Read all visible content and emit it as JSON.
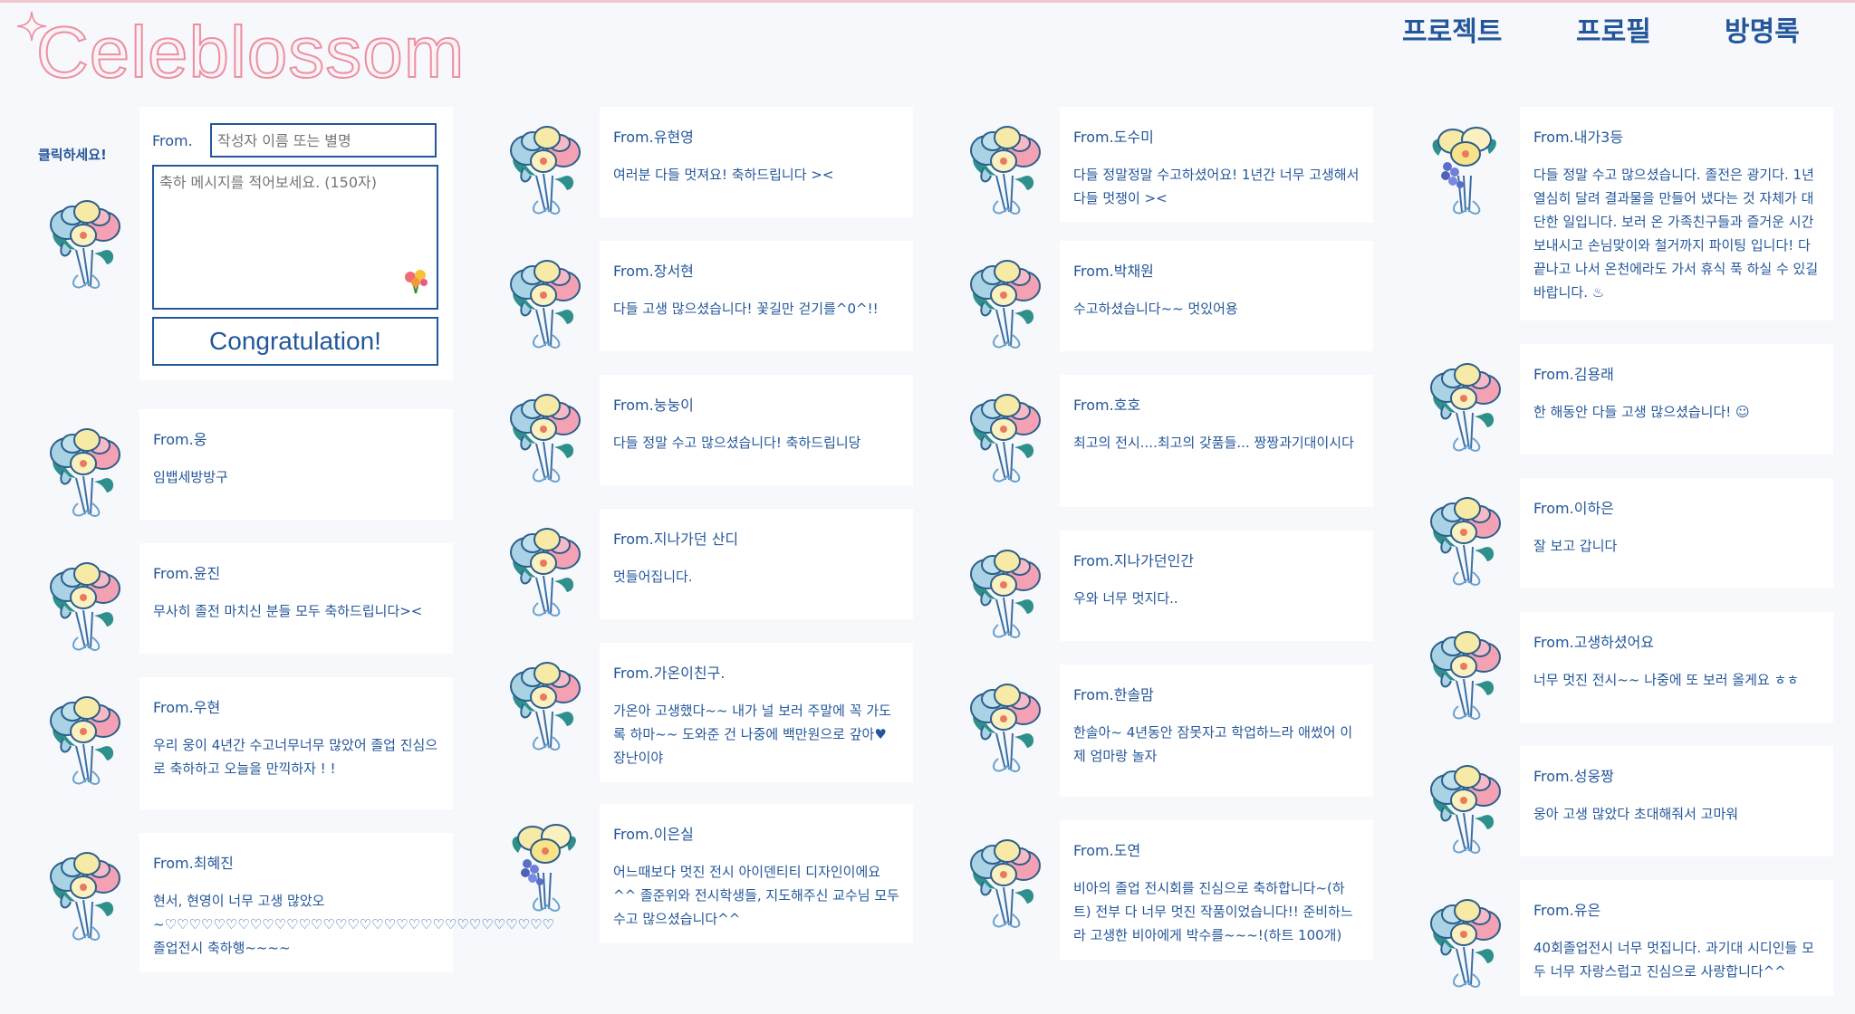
{
  "brand": {
    "logo_text": "Celeblossom"
  },
  "nav": [
    "프로젝트",
    "프로필",
    "방명록"
  ],
  "composer": {
    "hint": "클릭하세요!",
    "from_label": "From.",
    "name_placeholder": "작성자 이름 또는 별명",
    "message_placeholder": "축하 메시지를 적어보세요. (150자)",
    "submit_label": "Congratulation!"
  },
  "columns": [
    [
      {
        "from": "From.웅",
        "message": "임뱁세방방구",
        "bouquet": "blue-pink"
      },
      {
        "from": "From.윤진",
        "message": "무사히 졸전 마치신 분들 모두 축하드립니다><",
        "bouquet": "blue-pink"
      },
      {
        "from": "From.우현",
        "message": "우리 웅이 4년간 수고너무너무 많았어 졸업 진심으로 축하하고 오늘을 만끽하자 ! !",
        "bouquet": "blue-pink"
      },
      {
        "from": "From.최혜진",
        "message": "현서, 현영이 너무 고생 많았오~♡♡♡♡♡♡♡♡♡♡♡♡♡♡♡♡♡♡♡♡♡♡♡♡♡♡♡♡♡♡♡♡ 졸업전시 축하행~~~~",
        "bouquet": "blue-pink"
      }
    ],
    [
      {
        "from": "From.유현영",
        "message": "여러분 다들 멋져요! 축하드립니다 ><",
        "bouquet": "blue-pink"
      },
      {
        "from": "From.장서현",
        "message": "다들 고생 많으셨습니다! 꽃길만 걷기를^0^!!",
        "bouquet": "blue-pink"
      },
      {
        "from": "From.눙눙이",
        "message": "다들 정말 수고 많으셨습니다! 축하드립니당",
        "bouquet": "blue-pink"
      },
      {
        "from": "From.지나가던 산디",
        "message": "멋들어집니다.",
        "bouquet": "blue-pink"
      },
      {
        "from": "From.가온이친구.",
        "message": "가온아 고생했다~~ 내가 널 보러 주말에 꼭 가도록 하마~~ 도와준 건 나중에 백만원으로 갚아♥ 장난이야",
        "bouquet": "blue-pink"
      },
      {
        "from": "From.이은실",
        "message": "어느때보다 멋진 전시 아이덴티티 디자인이에요^^ 졸준위와 전시학생들, 지도해주신 교수님 모두수고 많으셨습니다^^",
        "bouquet": "yellow-purple"
      }
    ],
    [
      {
        "from": "From.도수미",
        "message": "다들 정말정말 수고하셨어요! 1년간 너무 고생해서 다들 멋쟁이 ><",
        "bouquet": "blue-pink"
      },
      {
        "from": "From.박채원",
        "message": "수고하셨습니다~~ 멋있어용",
        "bouquet": "blue-pink"
      },
      {
        "from": "From.호호",
        "message": "최고의 전시....최고의 갖품들... 짱짱과기대이시다",
        "bouquet": "blue-pink"
      },
      {
        "from": "From.지나가던인간",
        "message": "우와 너무 멋지다..",
        "bouquet": "blue-pink"
      },
      {
        "from": "From.한솔맘",
        "message": "한솔아~ 4년동안 잠못자고 학업하느라 애썼어 이제 엄마랑 놀자",
        "bouquet": "blue-pink"
      },
      {
        "from": "From.도연",
        "message": "비아의 졸업 전시회를 진심으로 축하합니다~(하트) 전부 다 너무 멋진 작품이었습니다!! 준비하느라 고생한 비아에게 박수를~~~!(하트 100개)",
        "bouquet": "blue-pink"
      }
    ],
    [
      {
        "from": "From.내가3등",
        "message": "다들 정말 수고 많으셨습니다. 졸전은 광기다. 1년 열심히 달려 결과물을 만들어 냈다는 것 자체가 대단한 일입니다. 보러 온 가족친구들과 즐거운 시간 보내시고 손님맞이와 철거까지 파이팅 입니다! 다 끝나고 나서 온천에라도 가서 휴식 푹 하실 수 있길 바랍니다. ♨",
        "bouquet": "yellow-purple"
      },
      {
        "from": "From.김용래",
        "message": "한 해동안 다들 고생 많으셨습니다! ☺",
        "bouquet": "blue-pink"
      },
      {
        "from": "From.이하은",
        "message": "잘 보고 갑니다",
        "bouquet": "blue-pink"
      },
      {
        "from": "From.고생하셨어요",
        "message": "너무 멋진 전시~~ 나중에 또 보러 올게요 ㅎㅎ",
        "bouquet": "blue-pink"
      },
      {
        "from": "From.성웅짱",
        "message": "웅아 고생 많았다 초대해줘서 고마워",
        "bouquet": "blue-pink"
      },
      {
        "from": "From.유은",
        "message": "40회졸업전시 너무 멋집니다. 과기대 시디인들 모두 너무 자랑스럽고 진심으로 사랑합니다^^",
        "bouquet": "blue-pink"
      }
    ]
  ]
}
